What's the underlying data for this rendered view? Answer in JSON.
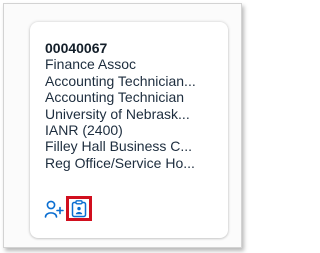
{
  "card": {
    "lines": [
      "00040067",
      "Finance Assoc",
      "Accounting Technician...",
      "Accounting Technician",
      "University of Nebrask...",
      "IANR (2400)",
      "Filley Hall Business C...",
      "Reg Office/Service Ho..."
    ]
  },
  "actions": [
    {
      "icon": "add-person-icon"
    },
    {
      "icon": "org-assignment-icon"
    }
  ],
  "colors": {
    "icon": "#0a6ed1",
    "highlight": "#d10f1e"
  }
}
